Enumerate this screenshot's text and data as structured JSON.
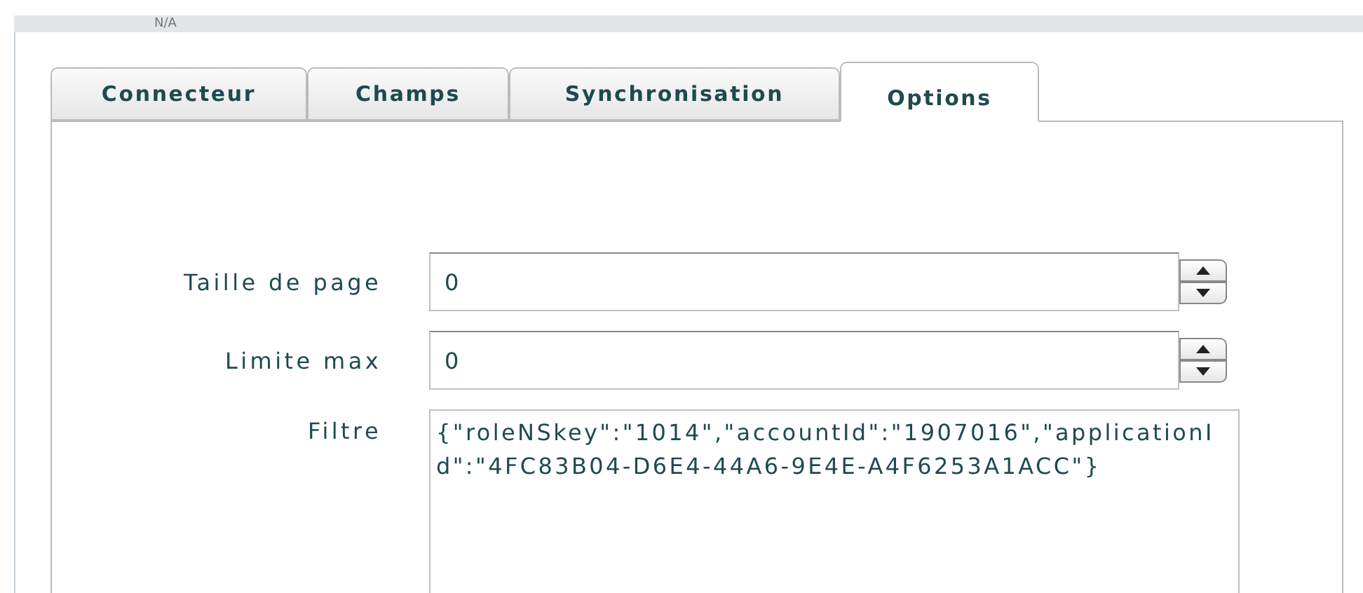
{
  "background": {
    "header_text": "N/A"
  },
  "tabs": [
    {
      "label": "Connecteur",
      "selected": false
    },
    {
      "label": "Champs",
      "selected": false
    },
    {
      "label": "Synchronisation",
      "selected": false
    },
    {
      "label": "Options",
      "selected": true
    }
  ],
  "fields": [
    {
      "kind": "spinner",
      "label": "Taille de page",
      "value": "0"
    },
    {
      "kind": "spinner",
      "label": "Limite max",
      "value": "0"
    },
    {
      "kind": "textarea",
      "label": "Filtre",
      "value": "{\"roleNSkey\":\"1014\",\"accountId\":\"1907016\",\"applicationId\":\"4FC83B04-D6E4-44A6-9E4E-A4F6253A1ACC\"}"
    }
  ]
}
